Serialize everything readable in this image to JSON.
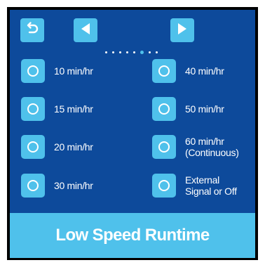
{
  "screen": {
    "title": "Low Speed Runtime",
    "icons": {
      "back": "undo-arrow-icon",
      "prev": "triangle-left-icon",
      "next": "triangle-right-icon"
    },
    "pagination": {
      "total": 8,
      "active_index": 5
    },
    "options": [
      {
        "label": "10 min/hr"
      },
      {
        "label": "40 min/hr"
      },
      {
        "label": "15 min/hr"
      },
      {
        "label": "50 min/hr"
      },
      {
        "label": "20 min/hr"
      },
      {
        "label": "60 min/hr\n(Continuous)"
      },
      {
        "label": "30 min/hr"
      },
      {
        "label": "External\nSignal or Off"
      }
    ],
    "colors": {
      "screen_bg": "#0d4a9b",
      "accent": "#4fc1eb",
      "text": "#ffffff",
      "frame": "#000000"
    }
  }
}
